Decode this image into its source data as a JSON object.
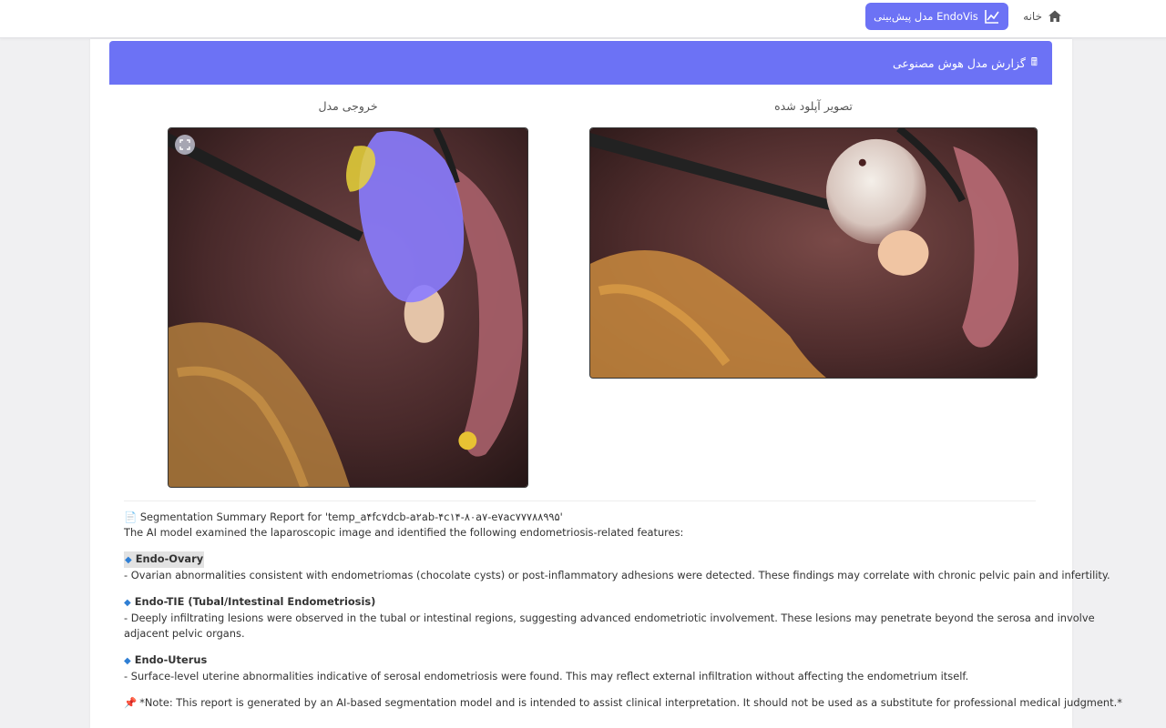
{
  "nav": {
    "home_label": "خانه",
    "model_button_label": "مدل پیش‌بینی EndoVis"
  },
  "card": {
    "header_title": "گزارش مدل هوش مصنوعی",
    "uploaded_title": "تصویر آپلود شده",
    "output_title": "خروجی مدل"
  },
  "report": {
    "title_icon": "📄",
    "title": "Segmentation Summary Report for 'temp_a۴fc۷dcb-a۲ab-۴c۱۴-۸۰a۷-e۷ac۷۷۷۸۸۹۹۵'",
    "intro": "The AI model examined the laparoscopic image and identified the following endometriosis-related features:",
    "sections": [
      {
        "heading": "Endo-Ovary",
        "lines": [
          "- Ovarian abnormalities consistent with endometriomas (chocolate cysts) or post-inflammatory adhesions were detected. These findings may correlate with chronic pelvic pain and infertility."
        ]
      },
      {
        "heading": "Endo-TIE (Tubal/Intestinal Endometriosis)",
        "lines": [
          "- Deeply infiltrating lesions were observed in the tubal or intestinal regions, suggesting advanced endometriotic involvement. These lesions may penetrate beyond the serosa and involve",
          "adjacent pelvic organs."
        ]
      },
      {
        "heading": "Endo-Uterus",
        "lines": [
          "- Surface-level uterine abnormalities indicative of serosal endometriosis were found. This may reflect external infiltration without affecting the endometrium itself."
        ]
      }
    ],
    "note": "*Note: This report is generated by an AI-based segmentation model and is intended to assist clinical interpretation. It should not be used as a substitute for professional medical judgment.*"
  },
  "icons": {
    "home": "home-icon",
    "chart": "line-chart-icon",
    "report": "document-icon",
    "expand": "fullscreen-icon",
    "diamond": "blue-diamond-icon",
    "pin": "pushpin-icon"
  },
  "colors": {
    "accent": "#6c72f5",
    "mask_ovary": "#8a7cff",
    "mask_uterus": "#e8d33a"
  }
}
